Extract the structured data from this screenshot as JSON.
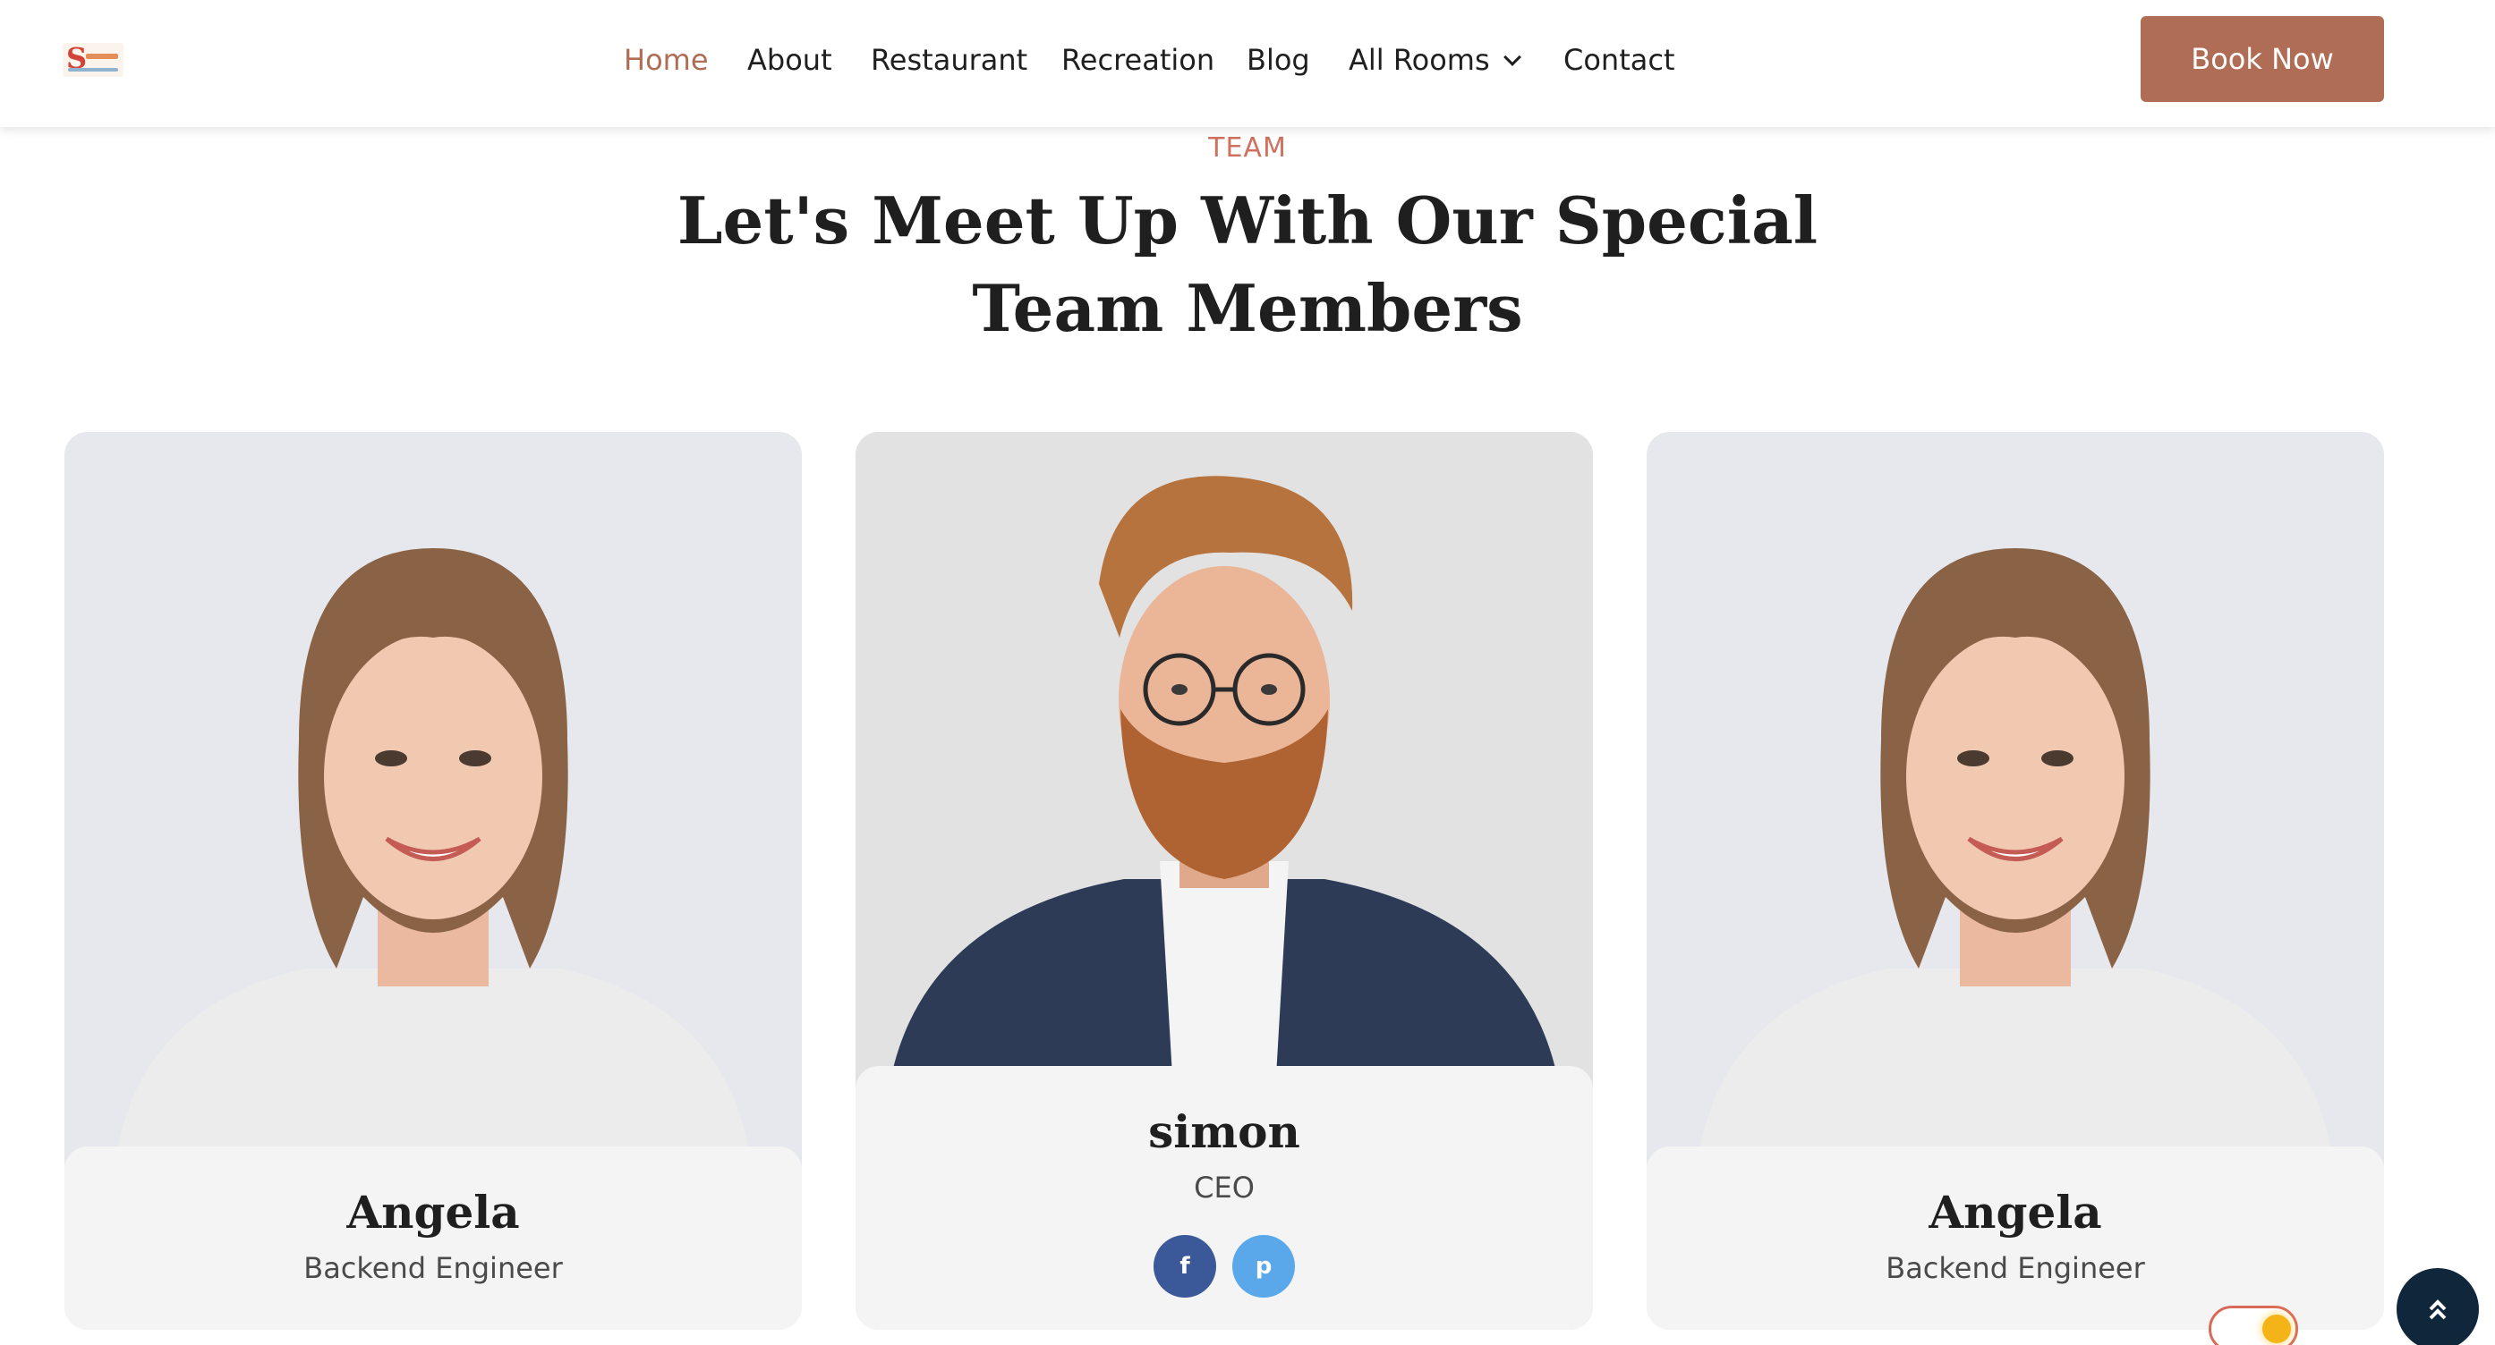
{
  "header": {
    "logo_alt": "Simon",
    "nav": [
      {
        "label": "Home",
        "active": true
      },
      {
        "label": "About",
        "active": false
      },
      {
        "label": "Restaurant",
        "active": false
      },
      {
        "label": "Recreation",
        "active": false
      },
      {
        "label": "Blog",
        "active": false
      },
      {
        "label": "All Rooms",
        "active": false,
        "has_dropdown": true
      },
      {
        "label": "Contact",
        "active": false
      }
    ],
    "cta_label": "Book Now"
  },
  "section": {
    "eyebrow": "TEAM",
    "title_line1": "Let's Meet Up With Our Special",
    "title_line2": "Team Members"
  },
  "team": [
    {
      "name": "Angela",
      "role": "Backend Engineer"
    },
    {
      "name": "simon",
      "role": "CEO",
      "socials": [
        "facebook-icon",
        "pinterest-icon"
      ]
    },
    {
      "name": "Angela",
      "role": "Backend Engineer"
    }
  ],
  "colors": {
    "accent": "#b06d56",
    "eyebrow": "#d0705f",
    "facebook": "#3b5998",
    "pinterest": "#5aa7ea",
    "scroll_top": "#10263a"
  },
  "icons": {
    "dropdown": "chevron-down-icon",
    "scroll_top": "double-chevron-up-icon",
    "theme_toggle": "sun-icon"
  }
}
